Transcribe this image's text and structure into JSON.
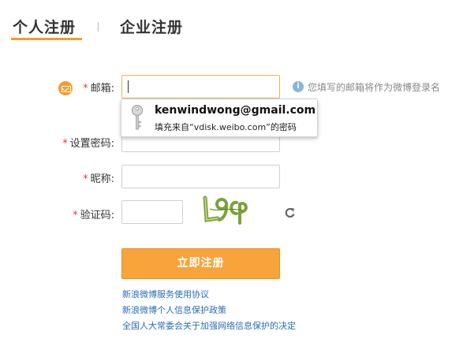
{
  "tabs": {
    "personal": "个人注册",
    "company": "企业注册"
  },
  "form": {
    "email_label": "邮箱:",
    "email_value": "",
    "email_hint": "您填写的邮箱将作为微博登录名",
    "password_label": "设置密码:",
    "nickname_label": "昵称:",
    "code_label": "验证码:",
    "required_mark": "*",
    "hint_icon": "i",
    "submit_label": "立即注册"
  },
  "autofill": {
    "email": "kenwindwong@gmail.com",
    "source": "填充来自“vdisk.weibo.com”的密码"
  },
  "captcha": {
    "text": "L9cp"
  },
  "links": [
    "新浪微博服务使用协议",
    "新浪微博个人信息保护政策",
    "全国人大常委会关于加强网络信息保护的决定"
  ],
  "colors": {
    "accent": "#f49a2f",
    "button": "#f8a43b",
    "link": "#2a6eb5",
    "required": "#e4393c"
  },
  "icons": {
    "mail": "mail-bubble-icon",
    "hint": "info-icon",
    "key": "key-icon",
    "refresh": "refresh-icon"
  }
}
